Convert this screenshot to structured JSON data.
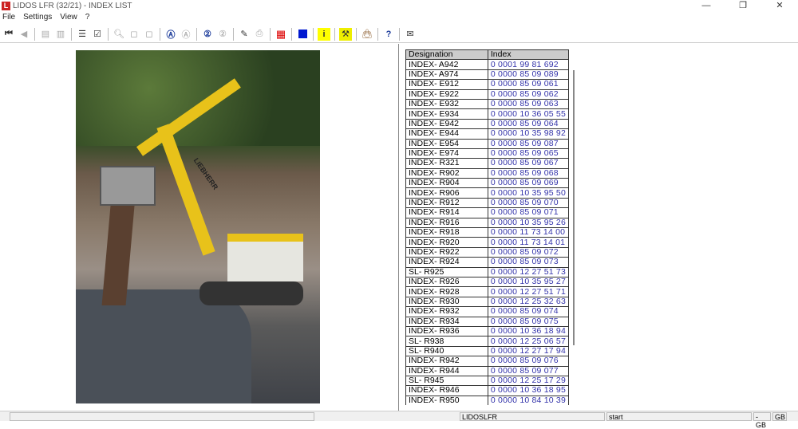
{
  "window": {
    "title": "LIDOS LFR (32/21) - INDEX LIST",
    "minimize": "—",
    "maximize": "❐",
    "close": "✕"
  },
  "menu": [
    "File",
    "Settings",
    "View",
    "?"
  ],
  "toolbar": [
    "first-record",
    "previous-record",
    "prev-page",
    "next-page",
    "print-list",
    "checklist",
    "zoom-in",
    "page-view",
    "page-fit",
    "search-a",
    "search-a-clear",
    "search-2",
    "search-2-clear",
    "edit",
    "print",
    "grid",
    "blue-square",
    "info",
    "tools",
    "bag",
    "lidos-help",
    "mail"
  ],
  "table": {
    "headers": [
      "Designation",
      "Index"
    ],
    "rows": [
      [
        "INDEX- A942",
        "0 0001 99 81 692"
      ],
      [
        "INDEX- A974",
        "0 0000 85 09 089"
      ],
      [
        "INDEX- E912",
        "0 0000 85 09 061"
      ],
      [
        "INDEX- E922",
        "0 0000 85 09 062"
      ],
      [
        "INDEX- E932",
        "0 0000 85 09 063"
      ],
      [
        "INDEX- E934",
        "0 0000 10 36 05 55"
      ],
      [
        "INDEX- E942",
        "0 0000 85 09 064"
      ],
      [
        "INDEX- E944",
        "0 0000 10 35 98 92"
      ],
      [
        "INDEX- E954",
        "0 0000 85 09 087"
      ],
      [
        "INDEX- E974",
        "0 0000 85 09 065"
      ],
      [
        "INDEX- R321",
        "0 0000 85 09 067"
      ],
      [
        "INDEX- R902",
        "0 0000 85 09 068"
      ],
      [
        "INDEX- R904",
        "0 0000 85 09 069"
      ],
      [
        "INDEX- R906",
        "0 0000 10 35 95 50"
      ],
      [
        "INDEX- R912",
        "0 0000 85 09 070"
      ],
      [
        "INDEX- R914",
        "0 0000 85 09 071"
      ],
      [
        "INDEX- R916",
        "0 0000 10 35 95 26"
      ],
      [
        "INDEX- R918",
        "0 0000 11 73 14 00"
      ],
      [
        "INDEX- R920",
        "0 0000 11 73 14 01"
      ],
      [
        "INDEX- R922",
        "0 0000 85 09 072"
      ],
      [
        "INDEX- R924",
        "0 0000 85 09 073"
      ],
      [
        "SL- R925",
        "0 0000 12 27 51 73"
      ],
      [
        "INDEX- R926",
        "0 0000 10 35 95 27"
      ],
      [
        "INDEX- R928",
        "0 0000 12 27 51 71"
      ],
      [
        "INDEX- R930",
        "0 0000 12 25 32 63"
      ],
      [
        "INDEX- R932",
        "0 0000 85 09 074"
      ],
      [
        "INDEX- R934",
        "0 0000 85 09 075"
      ],
      [
        "INDEX- R936",
        "0 0000 10 36 18 94"
      ],
      [
        "SL- R938",
        "0 0000 12 25 06 57"
      ],
      [
        "SL- R940",
        "0 0000 12 27 17 94"
      ],
      [
        "INDEX- R942",
        "0 0000 85 09 076"
      ],
      [
        "INDEX- R944",
        "0 0000 85 09 077"
      ],
      [
        "SL- R945",
        "0 0000 12 25 17 29"
      ],
      [
        "INDEX- R946",
        "0 0000 10 36 18 95"
      ],
      [
        "INDEX- R950",
        "0 0000 10 84 10 39"
      ]
    ]
  },
  "image": {
    "brand_text": "LIEBHERR"
  },
  "status": {
    "app": "LIDOSLFR",
    "state": "start",
    "lang1": "- GB",
    "lang2": "GB"
  }
}
